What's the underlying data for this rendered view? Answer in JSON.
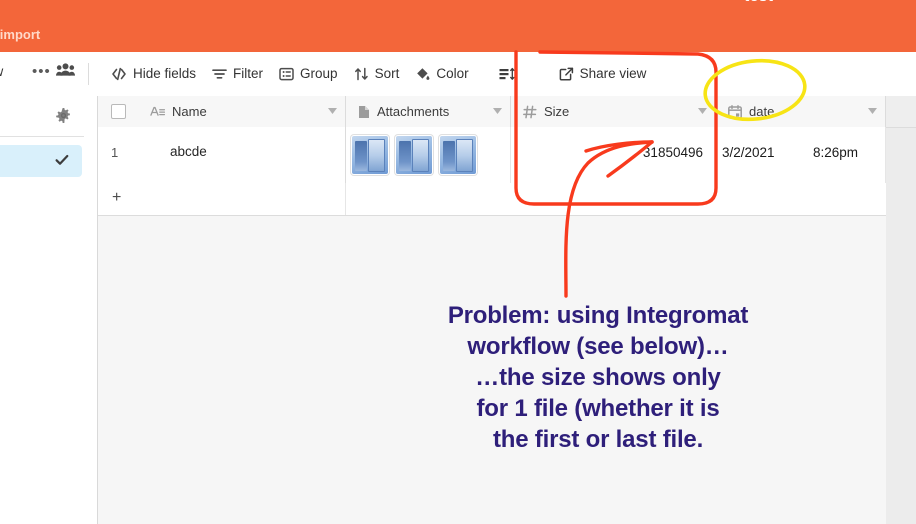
{
  "app": {
    "title": "test",
    "add_import_label": "ld or import",
    "brand_color": "#f3663a"
  },
  "toolbar": {
    "view_name": "ew",
    "more_label": "•••",
    "collaborators_icon": "people-icon",
    "items": [
      {
        "label": "Hide fields",
        "icon": "hide-fields-icon"
      },
      {
        "label": "Filter",
        "icon": "filter-icon"
      },
      {
        "label": "Group",
        "icon": "group-icon"
      },
      {
        "label": "Sort",
        "icon": "sort-icon"
      },
      {
        "label": "Color",
        "icon": "color-icon"
      },
      {
        "label": "",
        "icon": "row-height-icon"
      },
      {
        "label": "Share view",
        "icon": "share-icon"
      }
    ]
  },
  "sidebar": {
    "gear_icon": "gear-icon",
    "selected_check_icon": "check-icon"
  },
  "grid": {
    "columns": [
      {
        "label": "Name",
        "icon": "text-field-icon",
        "type": "text"
      },
      {
        "label": "Attachments",
        "icon": "attachment-icon",
        "type": "attachment"
      },
      {
        "label": "Size",
        "icon": "number-field-icon",
        "type": "number"
      },
      {
        "label": "date",
        "icon": "date-field-icon",
        "type": "date"
      }
    ],
    "rows": [
      {
        "number": "1",
        "name": "abcde",
        "attachment_count": 3,
        "size": "31850496",
        "date": "3/2/2021",
        "time": "8:26pm"
      }
    ],
    "add_row_label": "+"
  },
  "annotations": {
    "text_color": "#2e1f7a",
    "highlight_box_color": "#f83a1d",
    "circle_color": "#f7e415",
    "lines": [
      "Problem: using Integromat",
      "workflow (see below)…",
      "…the size shows only",
      "for 1 file (whether it is",
      "the first or last file."
    ]
  }
}
